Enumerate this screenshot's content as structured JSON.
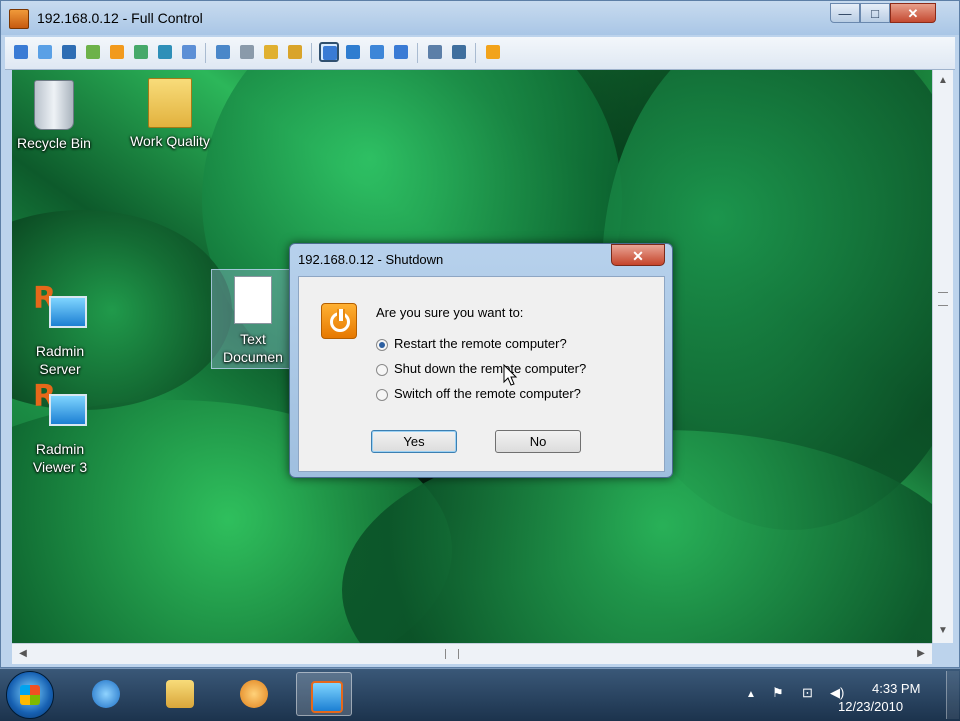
{
  "window": {
    "title": "192.168.0.12 - Full Control",
    "controls": {
      "minimize": "—",
      "maximize": "□",
      "close": "✕"
    }
  },
  "toolbar": {
    "icons": [
      "screen-icon",
      "screen-alt-icon",
      "terminal-icon",
      "transfer-icon",
      "power-icon",
      "chat-icon",
      "voice-chat-icon",
      "message-icon",
      "send-icon",
      "connect-icon",
      "lock-icon",
      "unlock-icon",
      "full-control-icon",
      "view-only-icon",
      "telnet-icon",
      "scale-icon",
      "fit-icon",
      "settings-icon",
      "tools-icon",
      "close-connection-icon"
    ]
  },
  "desktop": {
    "icons": [
      {
        "label": "Recycle Bin"
      },
      {
        "label": "Work Quality"
      },
      {
        "label_line1": "Radmin",
        "label_line2": "Server"
      },
      {
        "label_line1": "Radmin",
        "label_line2": "Viewer 3"
      },
      {
        "label_line1": "Text",
        "label_line2": "Documen"
      }
    ]
  },
  "dialog": {
    "title": "192.168.0.12 - Shutdown",
    "close": "✕",
    "prompt": "Are you sure you want to:",
    "options": [
      {
        "label": "Restart the remote computer?",
        "selected": true
      },
      {
        "label": "Shut down the remote computer?",
        "selected": false
      },
      {
        "label": "Switch off the remote computer?",
        "selected": false
      }
    ],
    "yes_label": "Yes",
    "no_label": "No"
  },
  "scrollbars": {
    "up": "▲",
    "down": "▼",
    "left": "◀",
    "right": "▶"
  },
  "taskbar": {
    "items": [
      "start-orb",
      "internet-explorer",
      "windows-explorer",
      "media-player",
      "radmin-viewer"
    ],
    "tray": {
      "up_arrow": "▲",
      "flag": "⚑",
      "network": "⊡",
      "volume": "◀)"
    },
    "time": "4:33 PM",
    "date": "12/23/2010"
  },
  "colors": {
    "accent": "#3c7fb1",
    "desktop_green": "#1f9a4b",
    "taskbar": "#1c334d"
  }
}
